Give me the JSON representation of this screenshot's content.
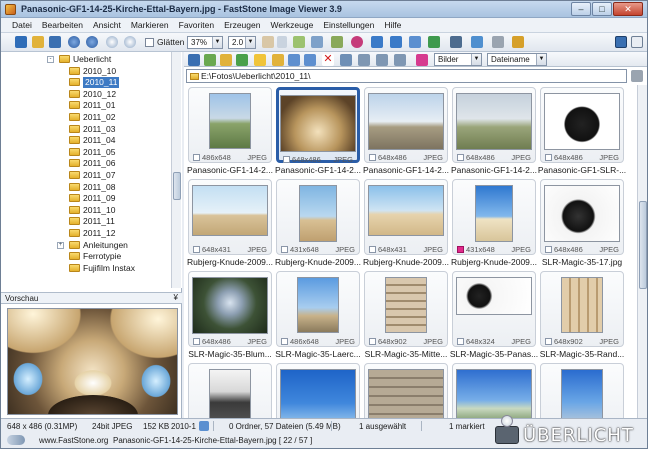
{
  "window": {
    "title": "Panasonic-GF1-14-25-Kirche-Ettal-Bayern.jpg  -  FastStone Image Viewer 3.9",
    "controls": [
      "–",
      "□",
      "✕"
    ]
  },
  "menubar": {
    "items": [
      "Datei",
      "Bearbeiten",
      "Ansicht",
      "Markieren",
      "Favoriten",
      "Erzeugen",
      "Werkzeuge",
      "Einstellungen",
      "Hilfe"
    ]
  },
  "toolbar": {
    "smooth_label": "Glätten",
    "zoom_value": "37%",
    "scale_value": "2.0"
  },
  "tree": {
    "items": [
      {
        "label": "Ueberlicht",
        "expander": "-",
        "selected": false
      },
      {
        "label": "2010_10",
        "selected": false
      },
      {
        "label": "2010_11",
        "selected": true
      },
      {
        "label": "2010_12",
        "selected": false
      },
      {
        "label": "2011_01",
        "selected": false
      },
      {
        "label": "2011_02",
        "selected": false
      },
      {
        "label": "2011_03",
        "selected": false
      },
      {
        "label": "2011_04",
        "selected": false
      },
      {
        "label": "2011_05",
        "selected": false
      },
      {
        "label": "2011_06",
        "selected": false
      },
      {
        "label": "2011_07",
        "selected": false
      },
      {
        "label": "2011_08",
        "selected": false
      },
      {
        "label": "2011_09",
        "selected": false
      },
      {
        "label": "2011_10",
        "selected": false
      },
      {
        "label": "2011_11",
        "selected": false
      },
      {
        "label": "2011_12",
        "selected": false
      },
      {
        "label": "Anleitungen",
        "expander": "+",
        "selected": false
      },
      {
        "label": "Ferrotypie",
        "selected": false
      },
      {
        "label": "Fujifilm Instax",
        "selected": false
      }
    ]
  },
  "preview": {
    "label": "Vorschau",
    "arrow": "¥"
  },
  "browser": {
    "path": "E:\\Fotos\\Ueberlicht\\2010_11\\",
    "filter": "Bilder",
    "sort": "Dateiname"
  },
  "thumbnails": [
    {
      "name": "Panasonic-GF1-14-2...",
      "dims": "486x648",
      "fmt": "JPEG",
      "selected": false,
      "mark": false
    },
    {
      "name": "Panasonic-GF1-14-2...",
      "dims": "648x486",
      "fmt": "JPEG",
      "selected": true,
      "mark": false
    },
    {
      "name": "Panasonic-GF1-14-2...",
      "dims": "648x486",
      "fmt": "JPEG",
      "selected": false,
      "mark": false
    },
    {
      "name": "Panasonic-GF1-14-2...",
      "dims": "648x486",
      "fmt": "JPEG",
      "selected": false,
      "mark": false
    },
    {
      "name": "Panasonic-GF1-SLR-...",
      "dims": "648x486",
      "fmt": "JPEG",
      "selected": false,
      "mark": false
    },
    {
      "name": "Rubjerg-Knude-2009...",
      "dims": "648x431",
      "fmt": "JPEG",
      "selected": false,
      "mark": false
    },
    {
      "name": "Rubjerg-Knude-2009...",
      "dims": "431x648",
      "fmt": "JPEG",
      "selected": false,
      "mark": false
    },
    {
      "name": "Rubjerg-Knude-2009...",
      "dims": "648x431",
      "fmt": "JPEG",
      "selected": false,
      "mark": false
    },
    {
      "name": "Rubjerg-Knude-2009...",
      "dims": "431x648",
      "fmt": "JPEG",
      "selected": false,
      "mark": true
    },
    {
      "name": "SLR-Magic-35-17.jpg",
      "dims": "648x486",
      "fmt": "JPEG",
      "selected": false,
      "mark": false
    },
    {
      "name": "SLR-Magic-35-Blum...",
      "dims": "648x486",
      "fmt": "JPEG",
      "selected": false,
      "mark": false
    },
    {
      "name": "SLR-Magic-35-Laerc...",
      "dims": "486x648",
      "fmt": "JPEG",
      "selected": false,
      "mark": false
    },
    {
      "name": "SLR-Magic-35-Mitte...",
      "dims": "648x902",
      "fmt": "JPEG",
      "selected": false,
      "mark": false
    },
    {
      "name": "SLR-Magic-35-Panas...",
      "dims": "648x324",
      "fmt": "JPEG",
      "selected": false,
      "mark": false
    },
    {
      "name": "SLR-Magic-35-Rand...",
      "dims": "648x902",
      "fmt": "JPEG",
      "selected": false,
      "mark": false
    },
    {
      "name": "",
      "dims": "",
      "fmt": "",
      "selected": false,
      "mark": false
    },
    {
      "name": "",
      "dims": "",
      "fmt": "",
      "selected": false,
      "mark": false
    },
    {
      "name": "",
      "dims": "",
      "fmt": "",
      "selected": false,
      "mark": false
    },
    {
      "name": "",
      "dims": "",
      "fmt": "",
      "selected": false,
      "mark": false
    },
    {
      "name": "",
      "dims": "",
      "fmt": "",
      "selected": false,
      "mark": false
    }
  ],
  "status": {
    "image_info": "648 x 486 (0.31MP)",
    "bit_depth": "24bit JPEG",
    "size": "152 KB",
    "date": "2010-1",
    "folder_count": "0 Ordner, 57 Dateien (5.49 MB)",
    "selected": "1 ausgewählt",
    "marked": "1 markiert",
    "website": "www.FastStone.org",
    "current_file": "Panasonic-GF1-14-25-Kirche-Ettal-Bayern.jpg [ 22 / 57 ]"
  },
  "watermark": {
    "text": "ÜBERLICHT"
  }
}
